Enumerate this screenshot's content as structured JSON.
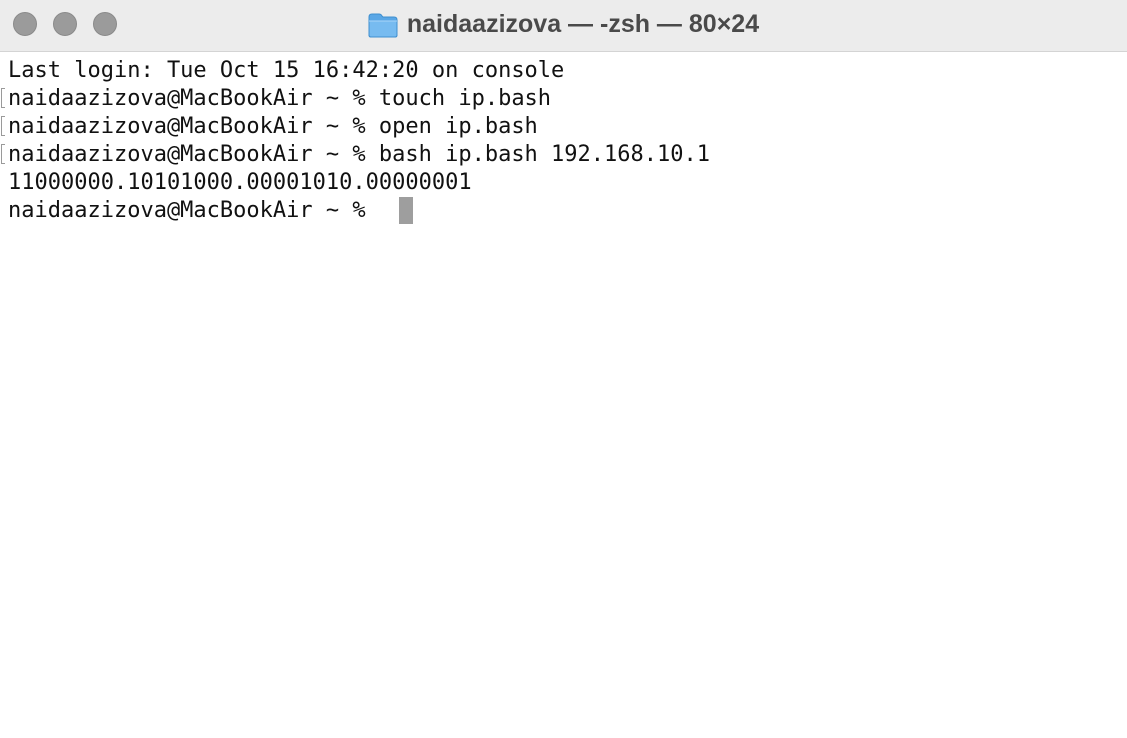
{
  "window": {
    "title": "naidaazizova — -zsh — 80×24",
    "folder_icon": "folder-icon",
    "traffic_lights": {
      "close": "close-button",
      "minimize": "minimize-button",
      "zoom": "zoom-button",
      "color": "#9b9b9b"
    }
  },
  "terminal": {
    "lines": [
      "Last login: Tue Oct 15 16:42:20 on console",
      "naidaazizova@MacBookAir ~ % touch ip.bash",
      "naidaazizova@MacBookAir ~ % open ip.bash",
      "naidaazizova@MacBookAir ~ % bash ip.bash 192.168.10.1",
      "11000000.10101000.00001010.00000001",
      "naidaazizova@MacBookAir ~ % "
    ],
    "cursor_color": "#9e9e9e"
  }
}
